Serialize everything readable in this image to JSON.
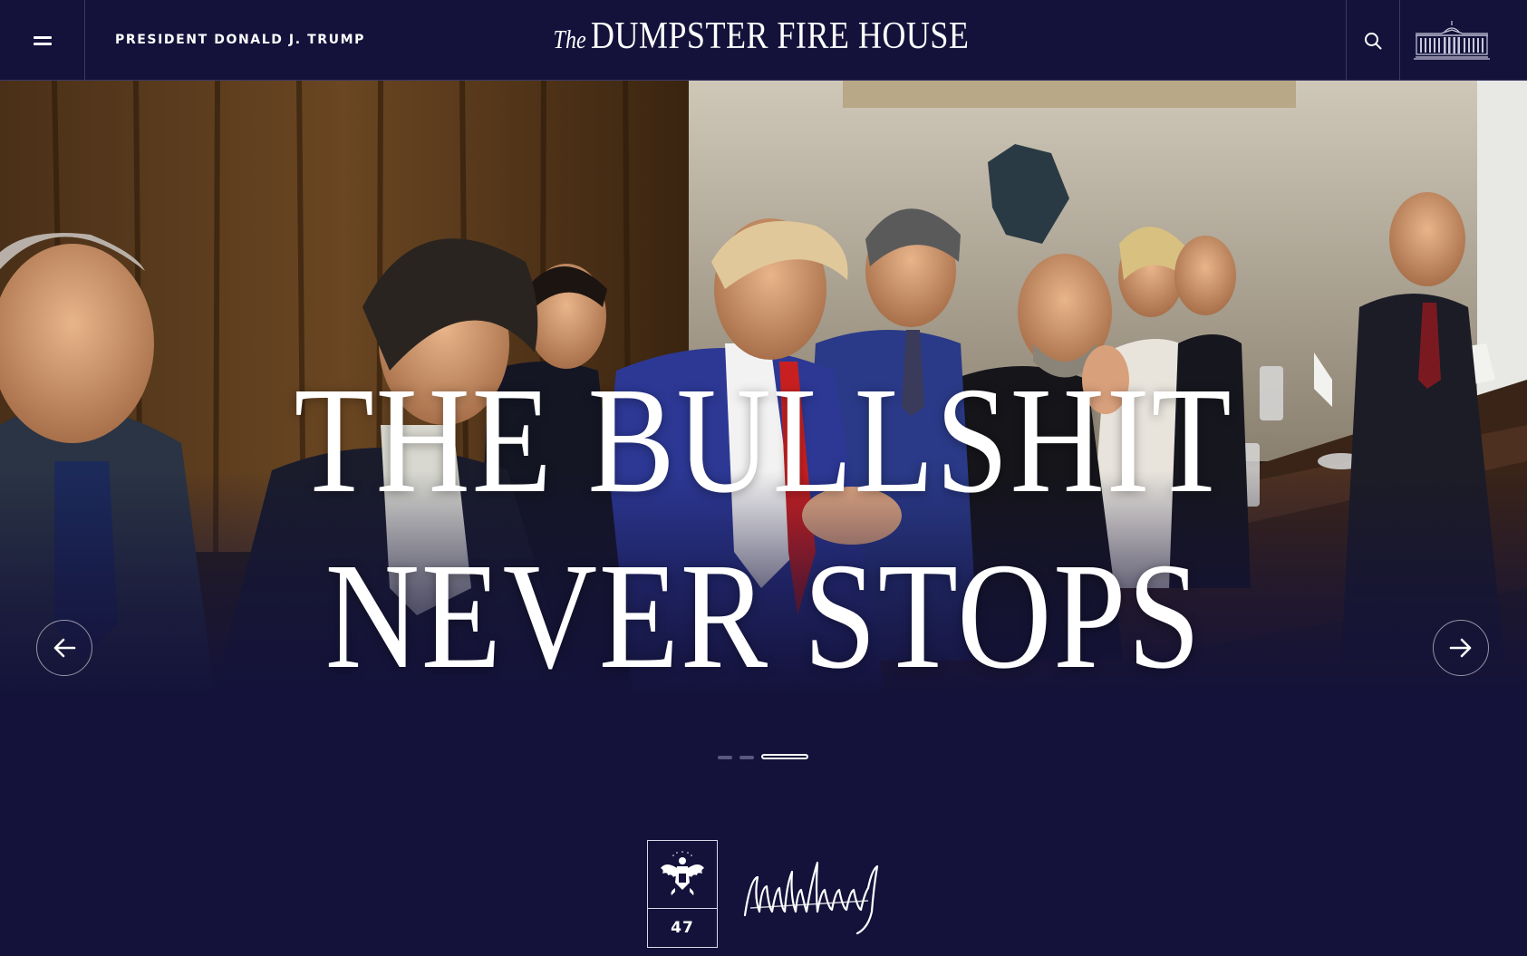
{
  "header": {
    "menu_icon": "hamburger-menu-icon",
    "president_link": "PRESIDENT DONALD J. TRUMP",
    "site_title_prefix": "The",
    "site_title": "DUMPSTER FIRE HOUSE",
    "search_icon": "search-icon",
    "logo_icon": "white-house-logo-icon"
  },
  "hero": {
    "headline_line1": "THE BULLSHIT",
    "headline_line2": "NEVER STOPS",
    "prev_icon": "arrow-left-icon",
    "next_icon": "arrow-right-icon",
    "slides": {
      "count": 3,
      "active": 3
    }
  },
  "footer_badge": {
    "seal_icon": "presidential-eagle-seal-icon",
    "number": "47",
    "signature_icon": "signature-image"
  },
  "colors": {
    "navy": "#14123a",
    "divider": "#3a3868",
    "white": "#ffffff"
  }
}
